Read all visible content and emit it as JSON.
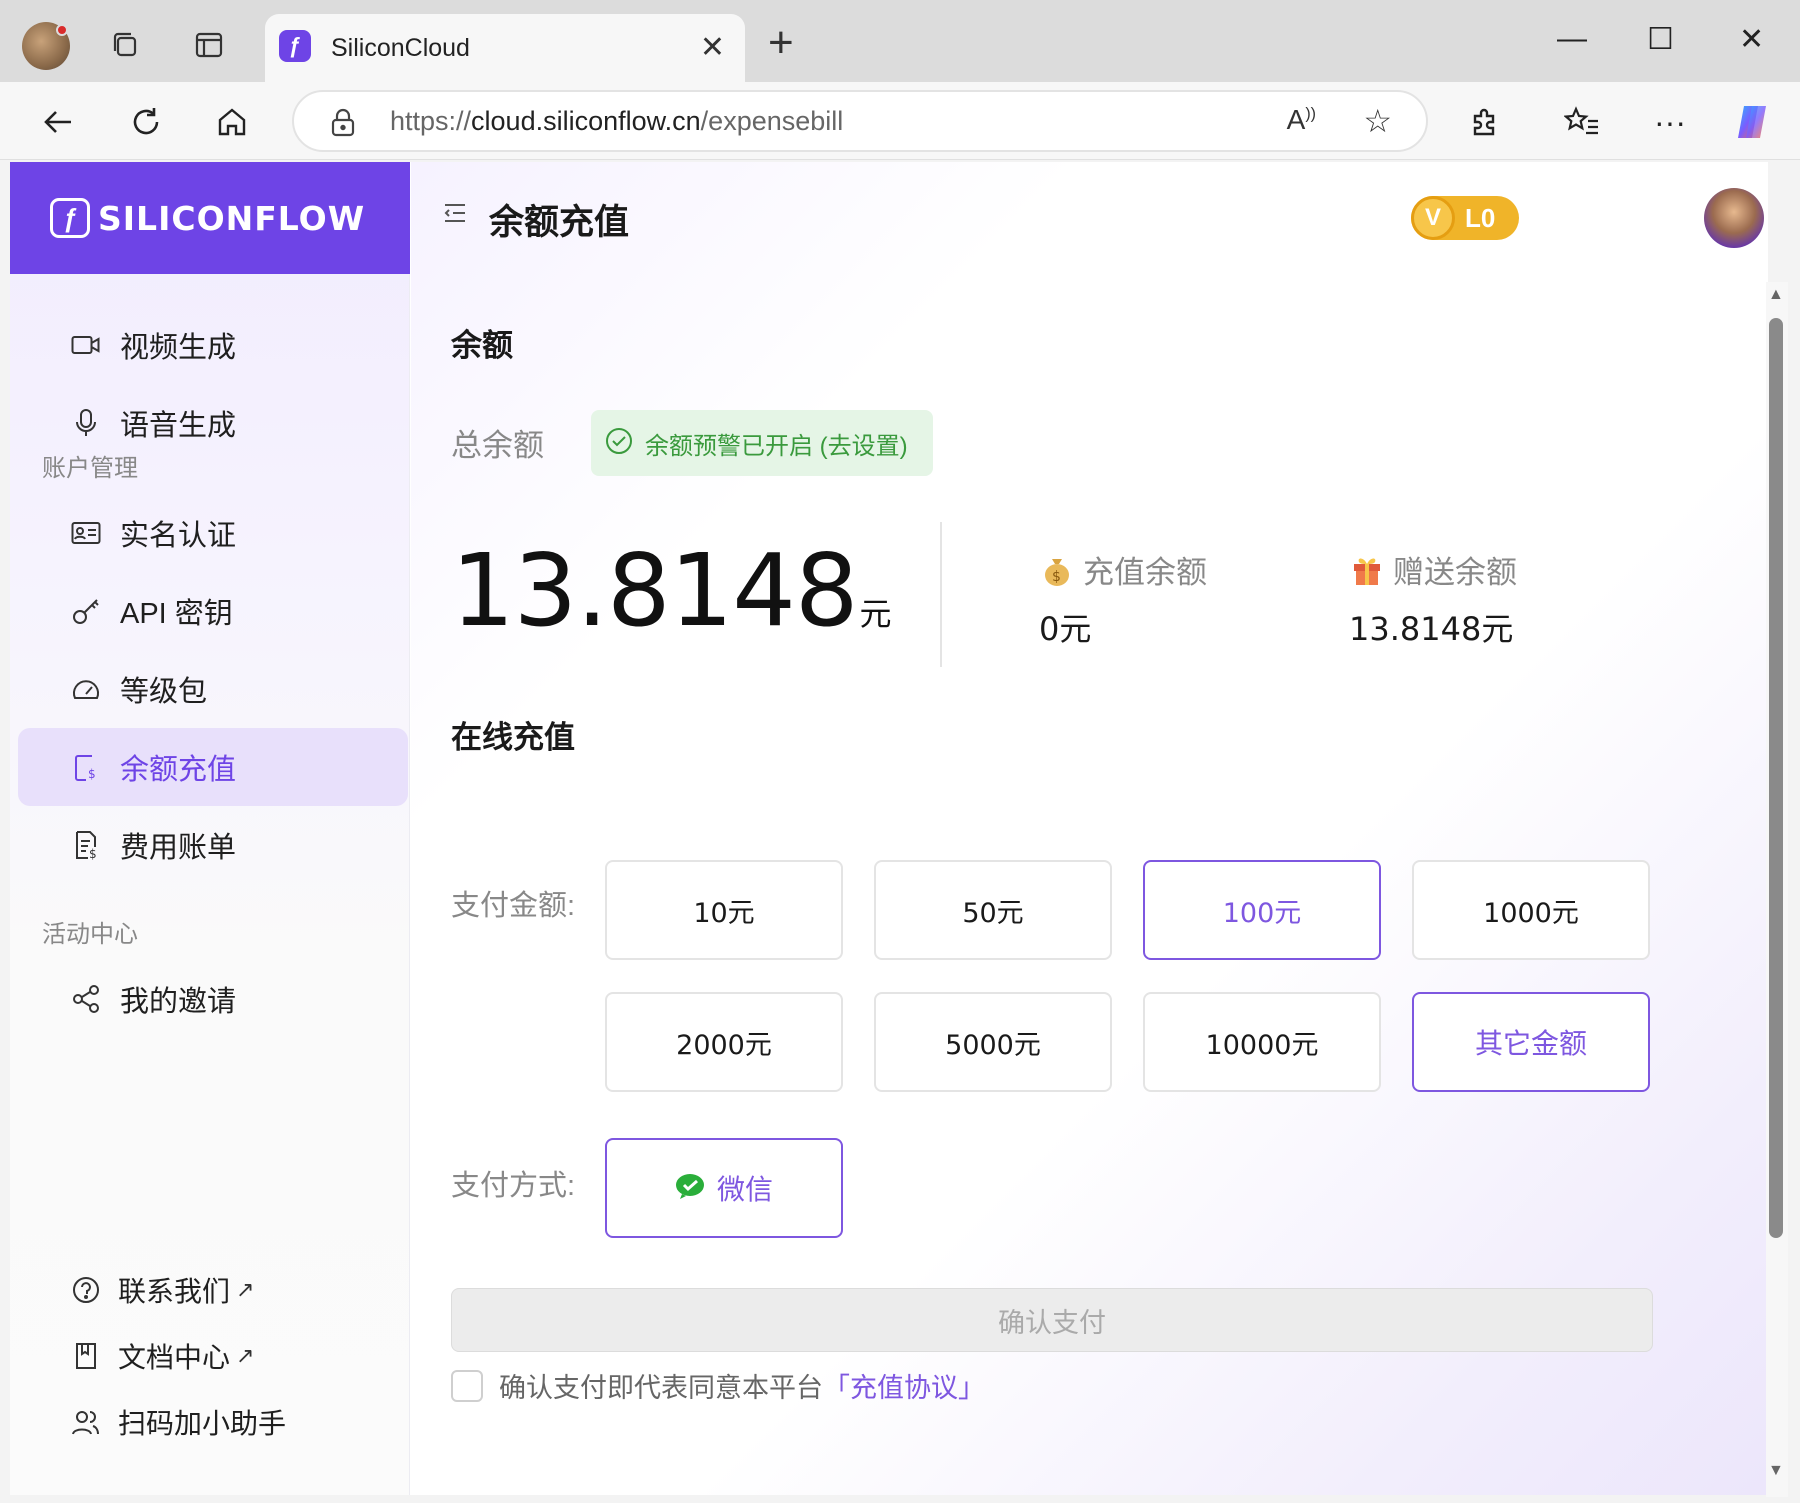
{
  "browser": {
    "tab_title": "SiliconCloud",
    "url_scheme": "https://",
    "url_host": "cloud.siliconflow.cn",
    "url_path": "/expensebill"
  },
  "brand": {
    "name": "SILICONFLOW"
  },
  "sidebar": {
    "top_items": [
      {
        "label": "视频生成",
        "icon": "video-icon"
      },
      {
        "label": "语音生成",
        "icon": "microphone-icon"
      }
    ],
    "account_section": "账户管理",
    "account_items": [
      {
        "label": "实名认证",
        "icon": "id-card-icon"
      },
      {
        "label": "API 密钥",
        "icon": "key-icon"
      },
      {
        "label": "等级包",
        "icon": "gauge-icon"
      },
      {
        "label": "余额充值",
        "icon": "recharge-icon",
        "active": true
      },
      {
        "label": "费用账单",
        "icon": "bill-icon"
      }
    ],
    "activity_section": "活动中心",
    "activity_items": [
      {
        "label": "我的邀请",
        "icon": "share-icon"
      }
    ],
    "footer": [
      {
        "label": "联系我们",
        "ext": "↗",
        "icon": "help-icon"
      },
      {
        "label": "文档中心",
        "ext": "↗",
        "icon": "book-icon"
      },
      {
        "label": "扫码加小助手",
        "icon": "users-icon"
      }
    ]
  },
  "header": {
    "title": "余额充值",
    "vip_level": "L0"
  },
  "balance": {
    "heading": "余额",
    "total_label": "总余额",
    "alert_text": "余额预警已开启 (去设置)",
    "total_value": "13.8148",
    "unit": "元",
    "recharge_label": "充值余额",
    "recharge_value": "0元",
    "gift_label": "赠送余额",
    "gift_value": "13.8148元"
  },
  "recharge": {
    "heading": "在线充值",
    "amount_label": "支付金额:",
    "amounts": [
      "10元",
      "50元",
      "100元",
      "1000元",
      "2000元",
      "5000元",
      "10000元",
      "其它金额"
    ],
    "selected_amount": "100元",
    "method_label": "支付方式:",
    "method": "微信",
    "confirm_label": "确认支付",
    "agree_text": "确认支付即代表同意本平台",
    "agree_link": "「充值协议」"
  },
  "colors": {
    "brand": "#6e44e6",
    "accent": "#7e57e0",
    "alert_bg": "#e5f5e6",
    "alert_text": "#3a9a3d",
    "vip": "#f0b429"
  }
}
